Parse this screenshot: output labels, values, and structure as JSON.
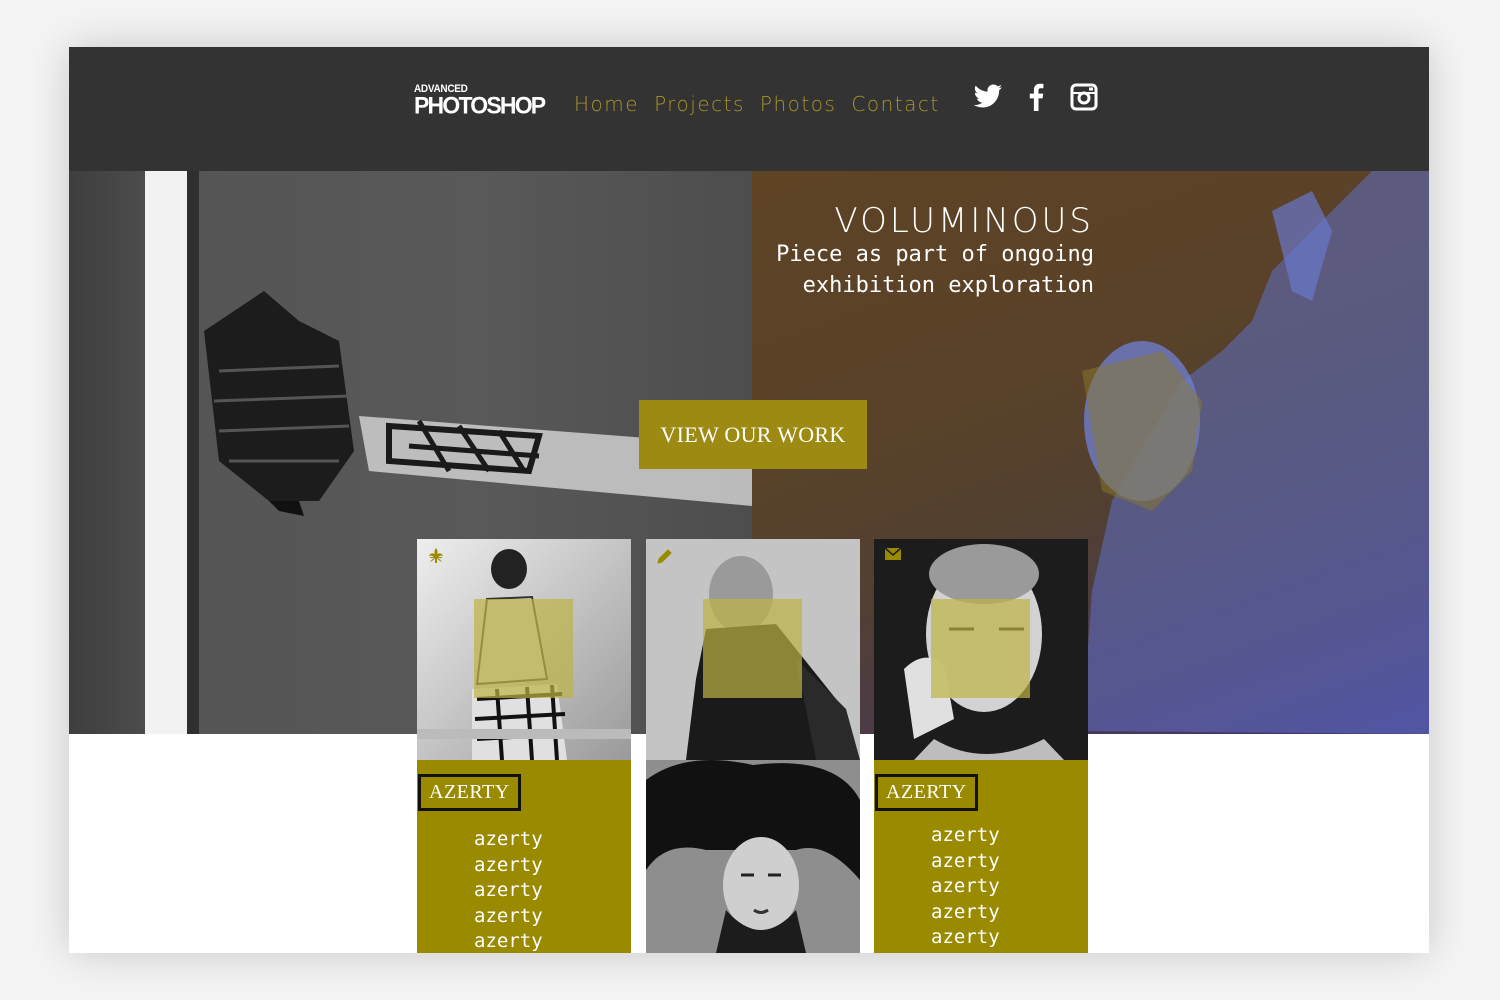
{
  "logo": {
    "line1": "ADVANCED",
    "line2": "PHOTOSHOP"
  },
  "nav": {
    "items": [
      "Home",
      "Projects",
      "Photos",
      "Contact"
    ]
  },
  "social": {
    "icons": [
      "twitter-icon",
      "facebook-icon",
      "instagram-icon"
    ]
  },
  "hero": {
    "title": "VOLUMINOUS",
    "subtitle": "Piece as part of ongoing exhibition exploration",
    "cta": "VIEW OUR WORK"
  },
  "cards": [
    {
      "corner_icon": "fleur-de-lis-icon",
      "tag": "AZERTY",
      "items": [
        "azerty",
        "azerty",
        "azerty",
        "azerty",
        "azerty"
      ]
    },
    {
      "corner_icon": "pencil-icon"
    },
    {
      "corner_icon": "envelope-icon",
      "tag": "AZERTY",
      "items": [
        "azerty",
        "azerty",
        "azerty",
        "azerty",
        "azerty"
      ]
    }
  ],
  "colors": {
    "header": "#333333",
    "accent": "#9a8a00",
    "nav_text": "#a8952a"
  }
}
